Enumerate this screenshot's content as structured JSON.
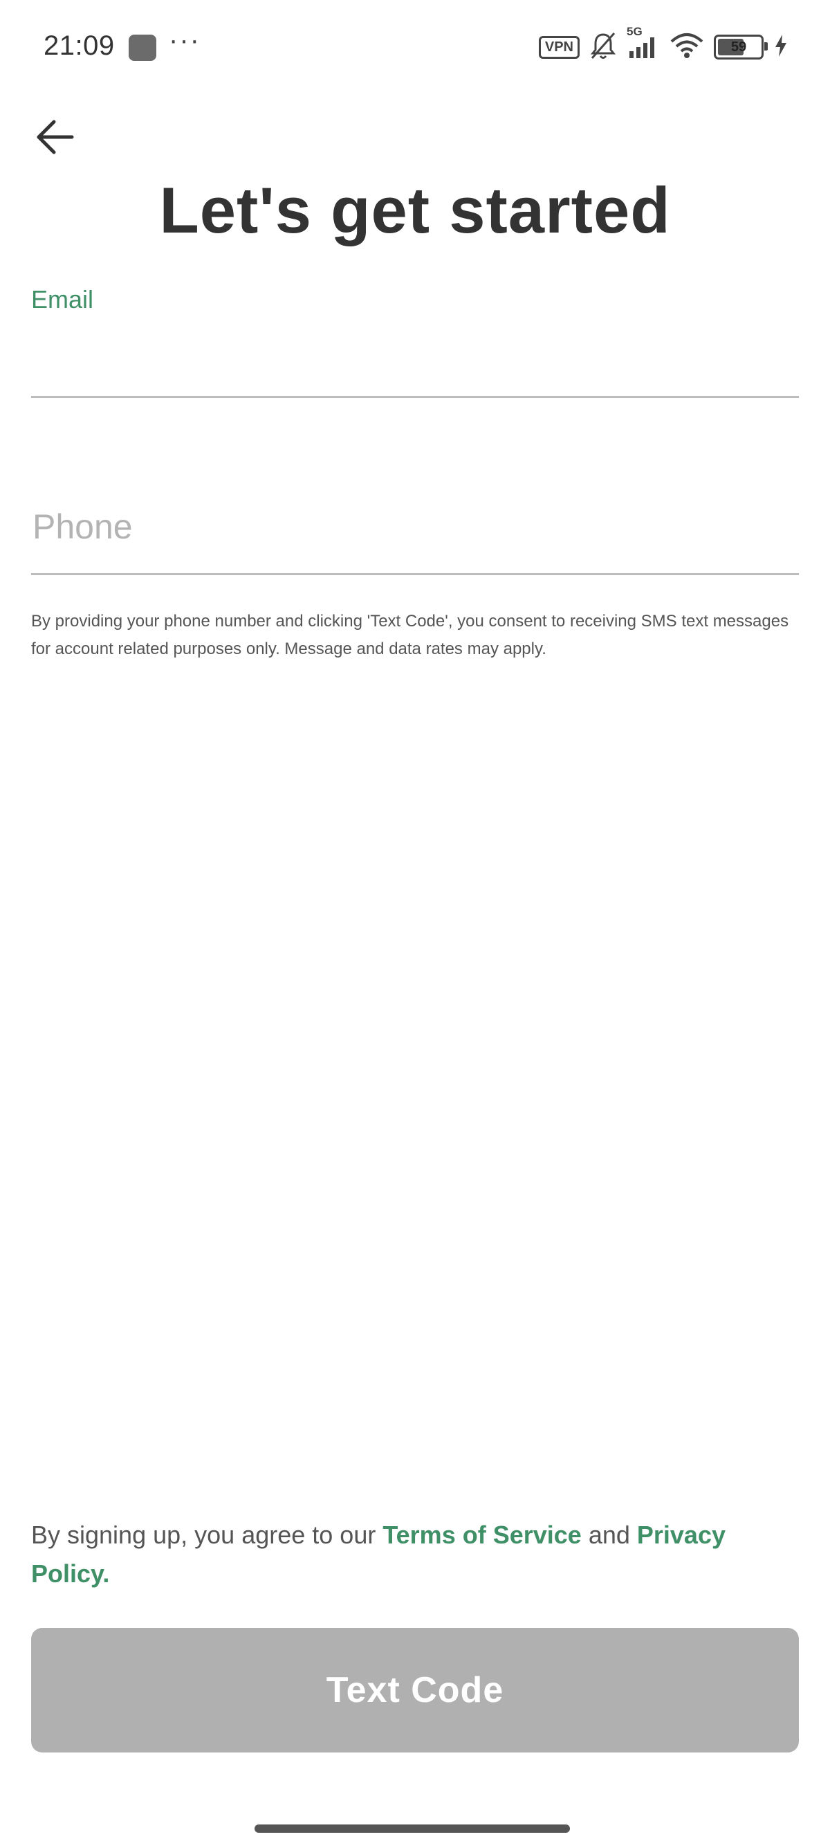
{
  "status_bar": {
    "time": "21:09",
    "more": "···",
    "vpn": "VPN",
    "network": "5G",
    "battery": "59",
    "icons": [
      "app-icon",
      "more-icon",
      "vpn-icon",
      "bell-muted-icon",
      "signal-icon",
      "wifi-icon",
      "battery-icon",
      "charging-icon"
    ]
  },
  "header": {
    "back_icon": "arrow-left-icon",
    "title": "Let's get started"
  },
  "form": {
    "email_label": "Email",
    "email_value": "",
    "phone_placeholder": "Phone",
    "phone_value": "",
    "consent_text": "By providing your phone number and clicking 'Text Code', you consent to receiving SMS text messages for account related purposes only. Message and data rates may apply."
  },
  "footer": {
    "agreement_prefix": "By signing up, you agree to our ",
    "terms_link": "Terms of Service",
    "agreement_middle": " and ",
    "privacy_link": "Privacy Policy",
    "agreement_suffix": ".",
    "button_label": "Text Code"
  },
  "colors": {
    "accent": "#3f8f67",
    "button_disabled": "#b0b0b0",
    "title": "#333333"
  }
}
